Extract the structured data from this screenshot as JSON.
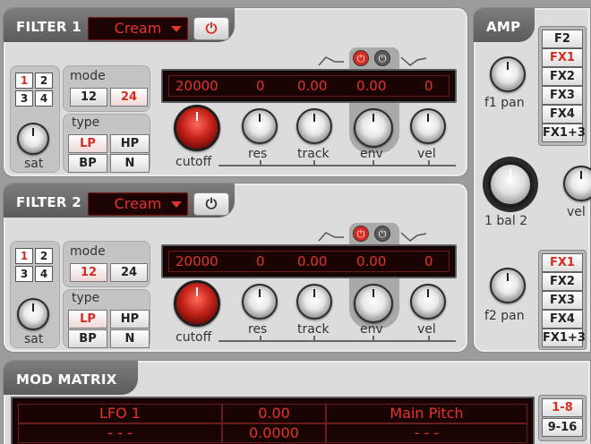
{
  "filter1": {
    "title": "FILTER 1",
    "preset": "Cream",
    "grid": [
      "1",
      "2",
      "3",
      "4"
    ],
    "active_grid": "1",
    "sat_label": "sat",
    "mode_label": "mode",
    "mode_options": [
      "12",
      "24"
    ],
    "mode_active": "24",
    "type_label": "type",
    "type_options": [
      "LP",
      "HP",
      "BP",
      "N"
    ],
    "type_active": "LP",
    "display": [
      "20000",
      "0",
      "0.00",
      "0.00",
      "0"
    ],
    "knobs": [
      "cutoff",
      "res",
      "track",
      "env",
      "vel"
    ]
  },
  "filter2": {
    "title": "FILTER 2",
    "preset": "Cream",
    "grid": [
      "1",
      "2",
      "3",
      "4"
    ],
    "active_grid": "1",
    "sat_label": "sat",
    "mode_label": "mode",
    "mode_options": [
      "12",
      "24"
    ],
    "mode_active": "12",
    "type_label": "type",
    "type_options": [
      "LP",
      "HP",
      "BP",
      "N"
    ],
    "type_active": "LP",
    "display": [
      "20000",
      "0",
      "0.00",
      "0.00",
      "0"
    ],
    "knobs": [
      "cutoff",
      "res",
      "track",
      "env",
      "vel"
    ]
  },
  "amp": {
    "title": "AMP",
    "f1_pan_label": "f1 pan",
    "f2_pan_label": "f2 pan",
    "bal_label": "1 bal 2",
    "vel_label": "vel",
    "fx_upper": [
      "F2",
      "FX1",
      "FX2",
      "FX3",
      "FX4",
      "FX1+3"
    ],
    "fx_upper_active": "FX1",
    "fx_lower": [
      "FX1",
      "FX2",
      "FX3",
      "FX4",
      "FX1+3"
    ],
    "fx_lower_active": "FX1"
  },
  "mod_matrix": {
    "title": "MOD MATRIX",
    "rows": [
      [
        "LFO 1",
        "0.00",
        "Main  Pitch"
      ],
      [
        "- - -",
        "0.0000",
        "- - -"
      ]
    ],
    "page_buttons": [
      "1-8",
      "9-16"
    ],
    "page_active": "1-8"
  },
  "colors": {
    "accent": "#d82b22",
    "lcd_bg": "#1a0303",
    "panel": "#dcdcdc",
    "header": "#6a6a6a"
  }
}
